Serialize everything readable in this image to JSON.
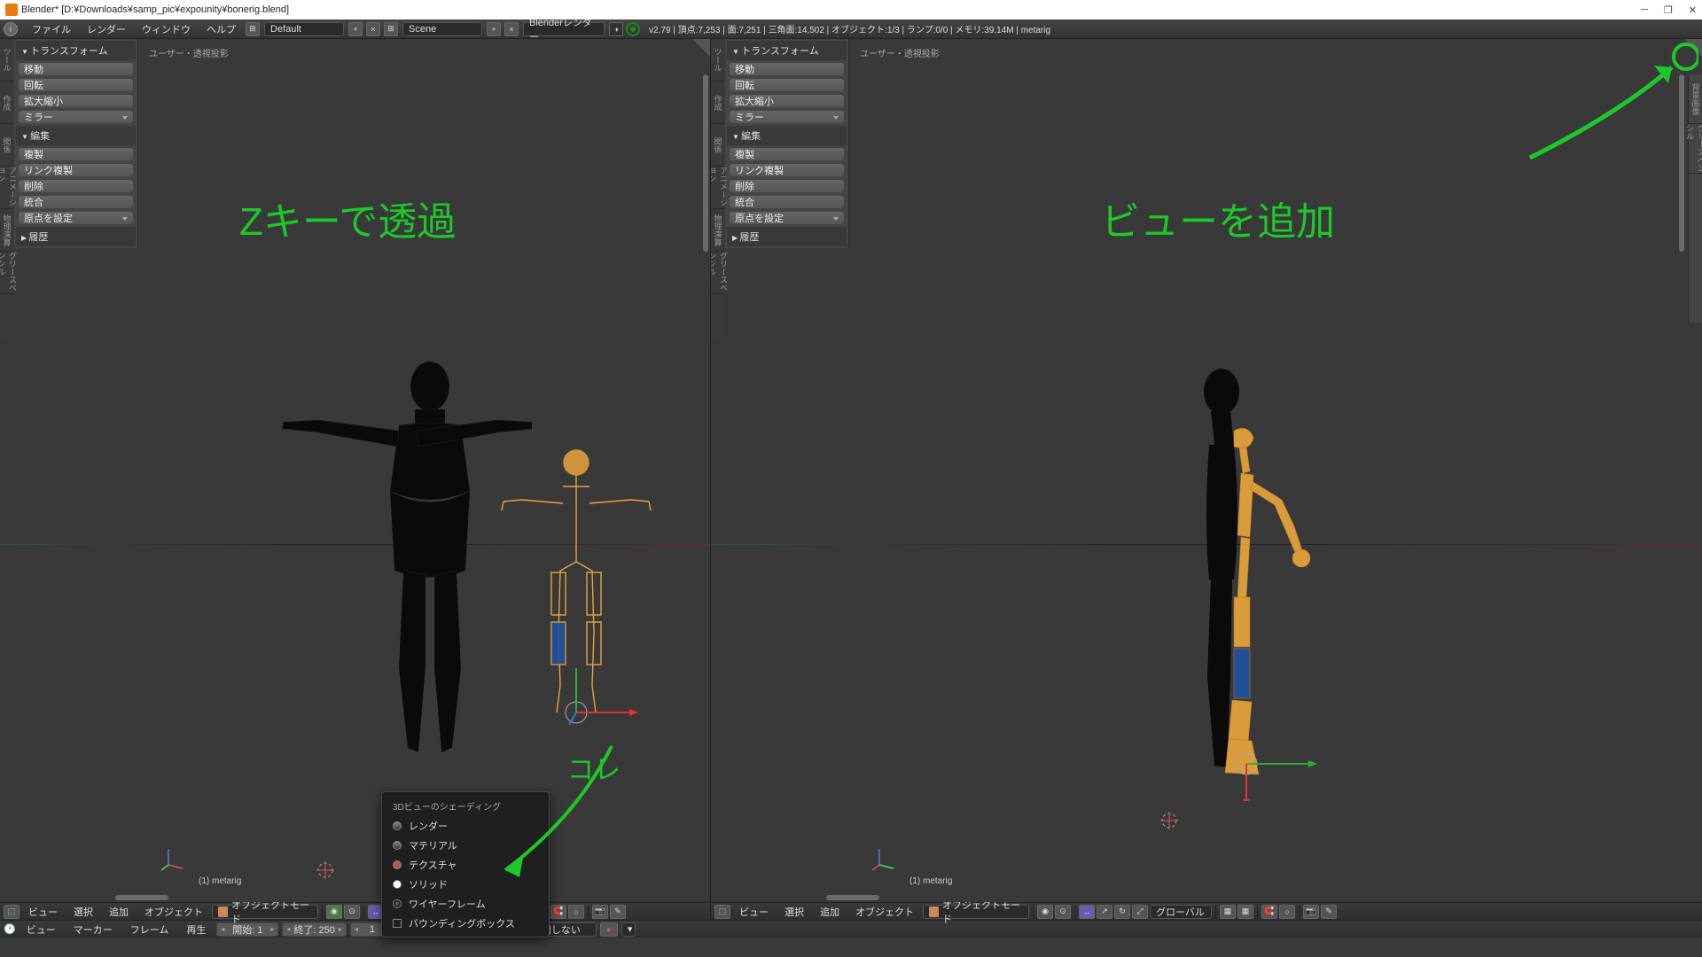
{
  "window": {
    "title": "Blender* [D:¥Downloads¥samp_pic¥expounity¥bonerig.blend]"
  },
  "topmenu": {
    "items": [
      "ファイル",
      "レンダー",
      "ウィンドウ",
      "ヘルプ"
    ],
    "layout_label": "Default",
    "scene_label": "Scene",
    "engine": "Blenderレンダー",
    "stats": "v2.79 | 頂点:7,253 | 面:7,251 | 三角面:14,502 | オブジェクト:1/3 | ランプ:0/0 | メモリ:39.14M | metarig"
  },
  "toolshelf": {
    "transform_header": "トランスフォーム",
    "move": "移動",
    "rotate": "回転",
    "scale": "拡大縮小",
    "mirror": "ミラー",
    "edit_header": "編集",
    "duplicate": "複製",
    "dup_linked": "リンク複製",
    "delete": "削除",
    "join": "統合",
    "set_origin": "原点を設定",
    "history_header": "履歴",
    "vtabs": [
      "ツール",
      "作成",
      "関係",
      "アニメーション",
      "物理演算",
      "グリースペンシル"
    ]
  },
  "viewports": {
    "left_label": "ユーザー・透視投影",
    "right_label": "ユーザー・透視投影",
    "object_name": "(1) metarig"
  },
  "annotations": {
    "left": "Zキーで透過",
    "right": "ビューを追加",
    "arrow": "コレ"
  },
  "shading_popup": {
    "title": "3Dビューのシェーディング",
    "items": [
      "レンダー",
      "マテリアル",
      "テクスチャ",
      "ソリッド",
      "ワイヤーフレーム",
      "バウンディングボックス"
    ]
  },
  "footer3d": {
    "view": "ビュー",
    "select": "選択",
    "add": "追加",
    "object": "オブジェクト",
    "mode": "オブジェクトモード",
    "orientation": "グローバル"
  },
  "timeline": {
    "view": "ビュー",
    "marker": "マーカー",
    "frame": "フレーム",
    "playback": "再生",
    "start_label": "開始:",
    "start_val": "1",
    "end_label": "終了:",
    "end_val": "250",
    "current_val": "1",
    "sync": "同期しない"
  },
  "n_panel_tabs": [
    "背景画像",
    "グリースペンシル"
  ]
}
